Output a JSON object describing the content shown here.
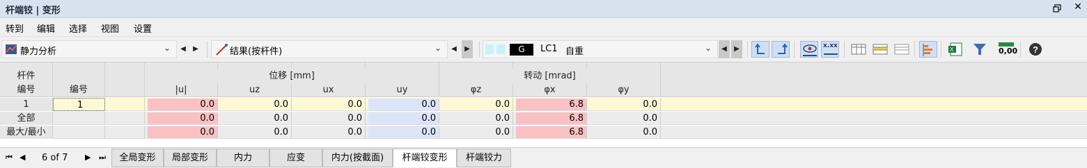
{
  "window": {
    "title": "杆端铰 | 变形"
  },
  "menu": [
    "转到",
    "编辑",
    "选择",
    "视图",
    "设置"
  ],
  "toolbar": {
    "analysis_combo": "静力分析",
    "result_combo": "结果(按杆件)",
    "lc_badge": "G",
    "lc_code": "LC1",
    "lc_name": "自重",
    "decimal_icon_text": "0,00",
    "xxx_icon_text": "x.xx"
  },
  "table": {
    "group_headers": {
      "member": "杆件",
      "displacement": "位移 [mm]",
      "rotation": "转动 [mrad]"
    },
    "member_col": "编号",
    "number_col": "编号",
    "columns": [
      "|u|",
      "uz",
      "ux",
      "uy",
      "φz",
      "φx",
      "φy"
    ],
    "rows": [
      {
        "member": "1",
        "number": "1",
        "values": [
          "0.0",
          "0.0",
          "0.0",
          "0.0",
          "0.0",
          "6.8",
          "0.0"
        ]
      },
      {
        "member": "全部",
        "number": "",
        "values": [
          "0.0",
          "0.0",
          "0.0",
          "0.0",
          "0.0",
          "6.8",
          "0.0"
        ]
      },
      {
        "member": "最大/最小",
        "number": "",
        "values": [
          "0.0",
          "0.0",
          "0.0",
          "0.0",
          "0.0",
          "6.8",
          "0.0"
        ]
      }
    ]
  },
  "pager": {
    "text": "6 of 7"
  },
  "tabs": [
    "全局变形",
    "局部变形",
    "内力",
    "应变",
    "内力(按截面)",
    "杆端铰变形",
    "杆端铰力"
  ],
  "active_tab": "杆端铰变形"
}
